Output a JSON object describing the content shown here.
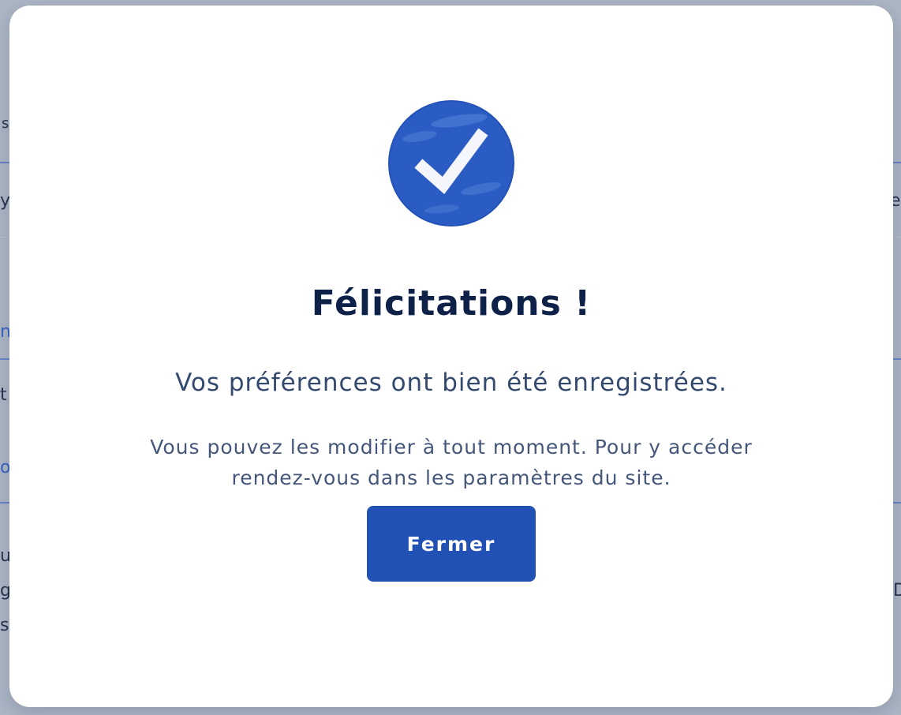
{
  "colors": {
    "overlay": "#667892",
    "accent": "#2151b5",
    "title": "#0e2149",
    "text": "#334a6e"
  },
  "background_fragments": [
    "s",
    "y",
    "e",
    "n",
    "t",
    "o",
    "u",
    "g",
    "s",
    "[",
    "D"
  ],
  "modal": {
    "icon": "success-check-icon",
    "title": "Félicitations !",
    "subtitle": "Vos préférences ont bien été enregistrées.",
    "info_line_1": "Vous pouvez les modifier à tout moment. Pour y accéder",
    "info_line_2": "rendez-vous dans les paramètres du site.",
    "close_label": "Fermer"
  }
}
